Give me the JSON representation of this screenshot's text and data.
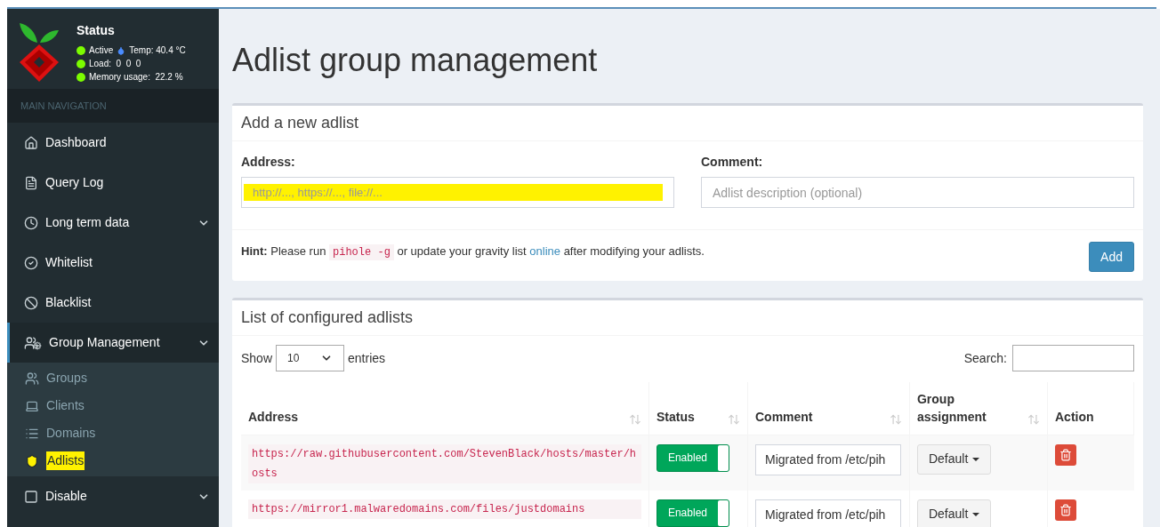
{
  "status": {
    "title": "Status",
    "temperature": "Temp: 40.4 °C",
    "lines": [
      {
        "text": "Active",
        "color": "#7cfc00"
      },
      {
        "text": "Load:  0  0  0",
        "color": "#7cfc00"
      },
      {
        "text": "Memory usage:  22.2 %",
        "color": "#7cfc00"
      }
    ]
  },
  "sidebar": {
    "header": "MAIN NAVIGATION",
    "items": [
      {
        "label": "Dashboard",
        "kind": "link",
        "selected": false
      },
      {
        "label": "Query Log",
        "kind": "link",
        "selected": false
      },
      {
        "label": "Long term data",
        "kind": "menu",
        "selected": false
      },
      {
        "label": "Whitelist",
        "kind": "link",
        "selected": false
      },
      {
        "label": "Blacklist",
        "kind": "link",
        "selected": false
      },
      {
        "label": "Group Management",
        "kind": "menu",
        "selected": true,
        "children": [
          {
            "label": "Groups",
            "selected": false
          },
          {
            "label": "Clients",
            "selected": false
          },
          {
            "label": "Domains",
            "selected": false
          },
          {
            "label": "Adlists",
            "selected": true
          }
        ]
      },
      {
        "label": "Disable",
        "kind": "menu",
        "selected": false
      }
    ]
  },
  "page_title": "Adlist group management",
  "add_card": {
    "title": "Add a new adlist",
    "address_label": "Address:",
    "address_placeholder": "http://..., https://..., file://...",
    "comment_label": "Comment:",
    "comment_placeholder": "Adlist description (optional)",
    "hint": {
      "bold": "Hint:",
      "before": "Please run",
      "code": "pihole -g",
      "middle": "or update your gravity list",
      "link": "online",
      "after": "after modifying your adlists."
    },
    "button": "Add"
  },
  "list_card": {
    "title": "List of configured adlists",
    "show_label": "Show",
    "page_size": "10",
    "entries_label": "entries",
    "search_label": "Search:",
    "columns": [
      "Address",
      "Status",
      "Comment",
      "Group assignment",
      "Action"
    ],
    "rows": [
      {
        "address": "https://raw.githubusercontent.com/StevenBlack/hosts/master/hosts",
        "status": "Enabled",
        "on": true,
        "comment": "Migrated from /etc/pih",
        "group": "Default"
      },
      {
        "address": "https://mirror1.malwaredomains.com/files/justdomains",
        "status": "Enabled",
        "on": true,
        "comment": "Migrated from /etc/pih",
        "group": "Default"
      }
    ]
  }
}
